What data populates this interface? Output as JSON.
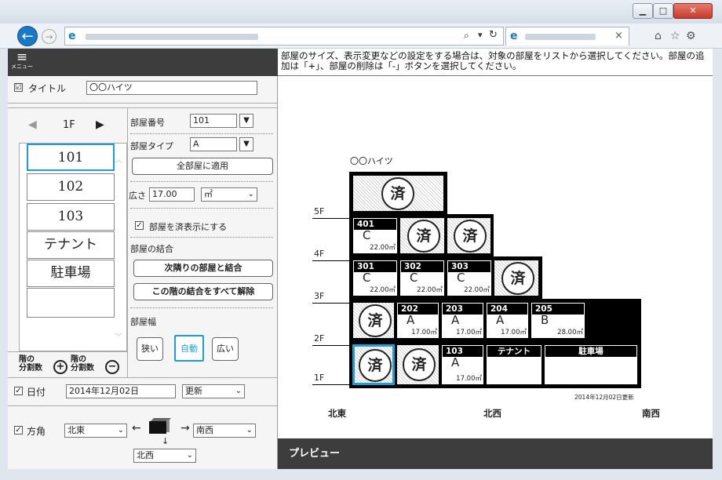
{
  "browser": {
    "tab_close": "×"
  },
  "instructions": "部屋のサイズ、表示変更などの設定をする場合は、対象の部屋をリストから選択してください。部屋の追加は「+」、部屋の削除は「-」ボタンを選択してください。",
  "menu": {
    "label": "メニュー"
  },
  "title_row": {
    "label": "タイトル",
    "value": "〇〇ハイツ",
    "checked": "☑"
  },
  "floor_nav": {
    "prev": "◀",
    "floor": "1F",
    "next": "▶"
  },
  "room_list": [
    "101",
    "102",
    "103",
    "テナント",
    "駐車場"
  ],
  "room_form": {
    "number_label": "部屋番号",
    "number_value": "101",
    "type_label": "部屋タイプ",
    "type_value": "A",
    "apply_all": "全部屋に適用",
    "area_label": "広さ",
    "area_value": "17.00",
    "area_unit": "㎡",
    "done_label": "部屋を済表示にする",
    "merge_label": "部屋の結合",
    "merge_next": "次隣りの部屋と結合",
    "merge_clear": "この階の結合をすべて解除",
    "width_label": "部屋幅",
    "width_narrow": "狭い",
    "width_auto": "自動",
    "width_wide": "広い"
  },
  "floor_divide": {
    "label1": "階の",
    "label2": "分割数"
  },
  "date_row": {
    "label": "日付",
    "value": "2014年12月02日",
    "select": "更新"
  },
  "direction_row": {
    "label": "方角",
    "left": "北東",
    "right": "南西",
    "bottom": "北西"
  },
  "preview": {
    "bar_label": "プレビュー",
    "title": "〇〇ハイツ",
    "date_note": "2014年12月02日更新",
    "dir_left": "北東",
    "dir_center": "北西",
    "dir_right": "南西",
    "floors": [
      "5F",
      "4F",
      "3F",
      "2F",
      "1F"
    ],
    "stamp": "済",
    "rooms": {
      "r401": {
        "no": "401",
        "type": "C",
        "size": "22.00㎡"
      },
      "r301": {
        "no": "301",
        "type": "C",
        "size": "22.00㎡"
      },
      "r302": {
        "no": "302",
        "type": "C",
        "size": "22.00㎡"
      },
      "r303": {
        "no": "303",
        "type": "C",
        "size": "22.00㎡"
      },
      "r202": {
        "no": "202",
        "type": "A",
        "size": "17.00㎡"
      },
      "r203": {
        "no": "203",
        "type": "A",
        "size": "17.00㎡"
      },
      "r204": {
        "no": "204",
        "type": "A",
        "size": "17.00㎡"
      },
      "r205": {
        "no": "205",
        "type": "B",
        "size": "28.00㎡"
      },
      "r103": {
        "no": "103",
        "type": "A",
        "size": "17.00㎡"
      },
      "tenant": {
        "no": "テナント"
      },
      "parking": {
        "no": "駐車場"
      }
    }
  },
  "colors": {
    "accent": "#1a9fd6",
    "dark_bar": "#3d3d3d"
  }
}
